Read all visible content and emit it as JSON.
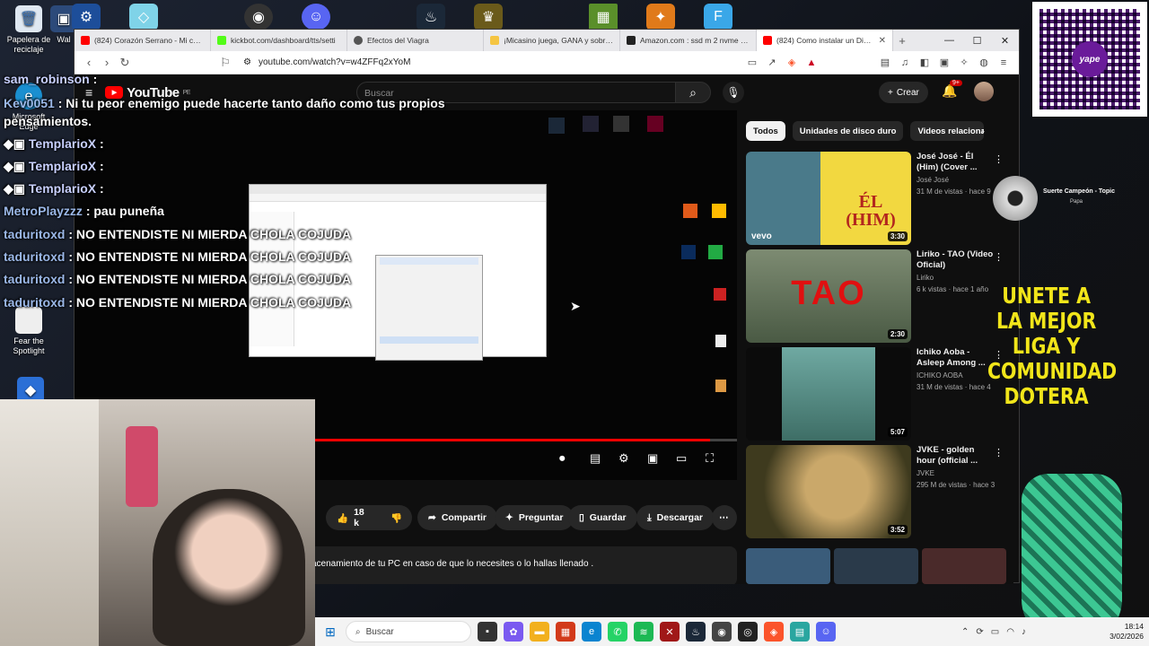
{
  "desktop": {
    "icons": [
      {
        "label": "Papelera de reciclaje",
        "icon": "recycle-bin-icon"
      },
      {
        "label": "Wal",
        "icon": "wallet-icon"
      },
      {
        "label": "Microsoft Edge",
        "icon": "edge-icon"
      },
      {
        "label": "Fear the Spotlight",
        "icon": "game-icon"
      }
    ]
  },
  "browser": {
    "tabs": [
      {
        "title": "(824) Corazón Serrano - Mi coraz",
        "color": "#ff0000"
      },
      {
        "title": "kickbot.com/dashboard/tts/setti",
        "color": "#53fc18"
      },
      {
        "title": "Efectos del Viagra",
        "color": "#555555"
      },
      {
        "title": "¡Micasino juega, GANA y sobre ta",
        "color": "#f5c542"
      },
      {
        "title": "Amazon.com : ssd m 2 nvme pcie",
        "color": "#222222"
      },
      {
        "title": "(824) Como instalar un Disco",
        "color": "#ff0000",
        "active": true
      }
    ],
    "url": "youtube.com/watch?v=w4ZFFq2xYoM"
  },
  "youtube": {
    "logo": "YouTube",
    "country": "PE",
    "search_placeholder": "Buscar",
    "create_label": "Crear",
    "notifications": "9+",
    "actions": {
      "likes": "18 k",
      "share": "Compartir",
      "ask": "Preguntar",
      "save": "Guardar",
      "download": "Descargar"
    },
    "description": "acenamiento de tu PC en caso de que lo necesites o lo hallas llenado .",
    "progress": 0.96,
    "chips": [
      "Todos",
      "Unidades de disco duro",
      "Videos relacionac"
    ],
    "recommendations": [
      {
        "title": "José José - Él (Him) (Cover ...",
        "channel": "José José",
        "meta": "31 M de vistas · hace 9",
        "duration": "3:30"
      },
      {
        "title": "Liriko - TAO (Video Oficial)",
        "channel": "Liriko",
        "meta": "6 k vistas · hace 1 año",
        "duration": "2:30"
      },
      {
        "title": "Ichiko Aoba - Asleep Among ...",
        "channel": "ICHIKO AOBA",
        "meta": "31 M de vistas · hace 4",
        "duration": "5:07"
      },
      {
        "title": "JVKE - golden hour (official ...",
        "channel": "JVKE",
        "meta": "295 M de vistas · hace 3",
        "duration": "3:52"
      }
    ],
    "thumb_texts": {
      "el_him": "ÉL (HIM)",
      "tao": "TAO",
      "vevo": "vevo"
    }
  },
  "chat": [
    {
      "user": "sam_robinson",
      "msg": ":"
    },
    {
      "user": "Kev0051",
      "msg": ": Ni tu peor enemigo puede hacerte tanto daño como tus propios pensamientos."
    },
    {
      "user": "TemplarioX",
      "msg": ":"
    },
    {
      "user": "TemplarioX",
      "msg": ":"
    },
    {
      "user": "TemplarioX",
      "msg": ":"
    },
    {
      "user": "MetroPlayzzz",
      "msg": ": pau puneña"
    },
    {
      "user": "taduritoxd",
      "msg": ": NO ENTENDISTE NI MIERDA CHOLA COJUDA"
    },
    {
      "user": "taduritoxd",
      "msg": ": NO ENTENDISTE NI MIERDA CHOLA COJUDA"
    },
    {
      "user": "taduritoxd",
      "msg": ": NO ENTENDISTE NI MIERDA CHOLA COJUDA"
    },
    {
      "user": "taduritoxd",
      "msg": ": NO ENTENDISTE NI MIERDA CHOLA COJUDA"
    }
  ],
  "overlay": {
    "promo": "UNETE A LA MEJOR LIGA Y COMUNIDAD DOTERA",
    "now_playing_title": "Suerte Campeón - Topic",
    "now_playing_artist": "Papa",
    "qr_label": "yape"
  },
  "taskbar": {
    "search": "Buscar",
    "time": "18:14",
    "date": "3/02/2026"
  }
}
